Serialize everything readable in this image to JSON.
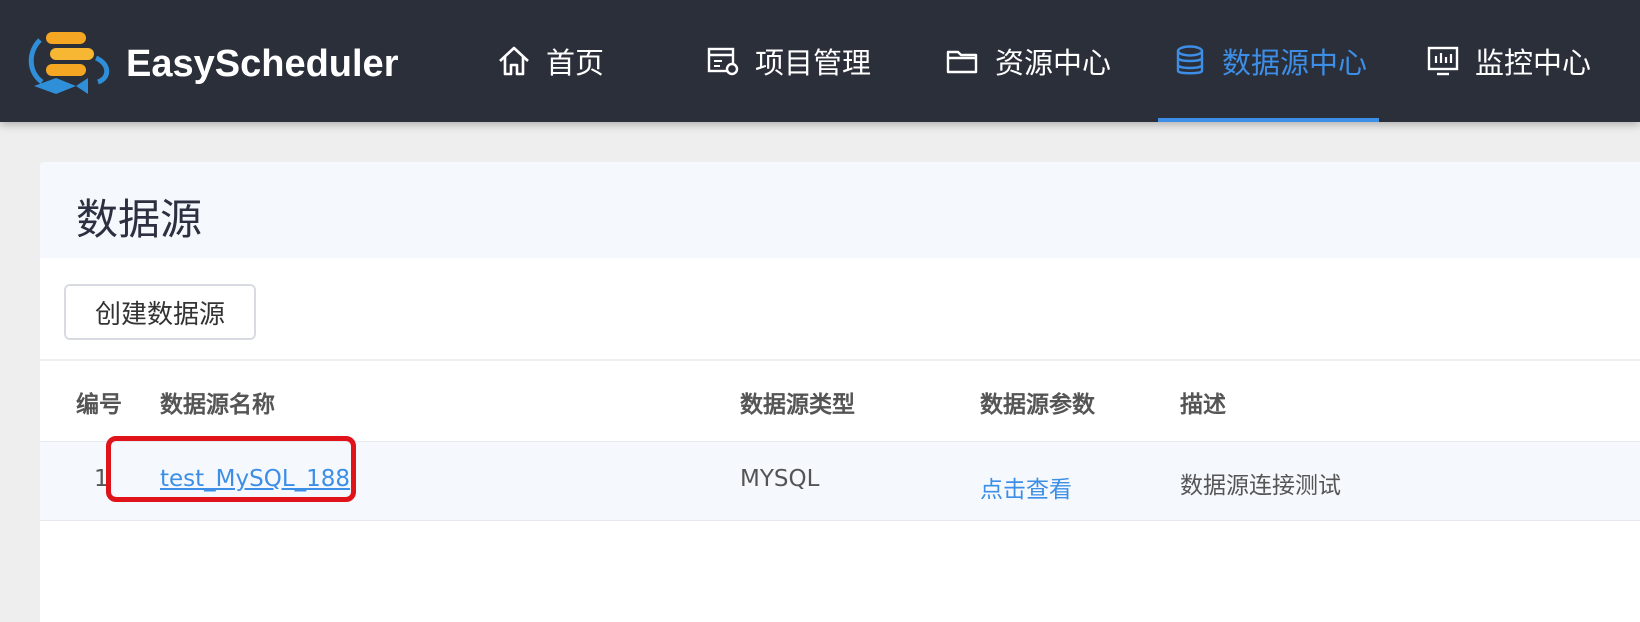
{
  "app": {
    "name": "EasyScheduler"
  },
  "nav": {
    "items": [
      {
        "label": "首页",
        "icon": "home-icon"
      },
      {
        "label": "项目管理",
        "icon": "project-settings-icon"
      },
      {
        "label": "资源中心",
        "icon": "folder-icon"
      },
      {
        "label": "数据源中心",
        "icon": "database-icon",
        "active": true
      },
      {
        "label": "监控中心",
        "icon": "monitor-icon"
      }
    ]
  },
  "colors": {
    "header_bg": "#2b2f3a",
    "accent": "#3c8ee6",
    "highlight": "#e0121a"
  },
  "page": {
    "title": "数据源",
    "create_button": "创建数据源"
  },
  "table": {
    "headers": [
      "编号",
      "数据源名称",
      "数据源类型",
      "数据源参数",
      "描述"
    ],
    "rows": [
      {
        "id": "1",
        "name": "test_MySQL_188",
        "type": "MYSQL",
        "params": "点击查看",
        "description": "数据源连接测试"
      }
    ]
  }
}
